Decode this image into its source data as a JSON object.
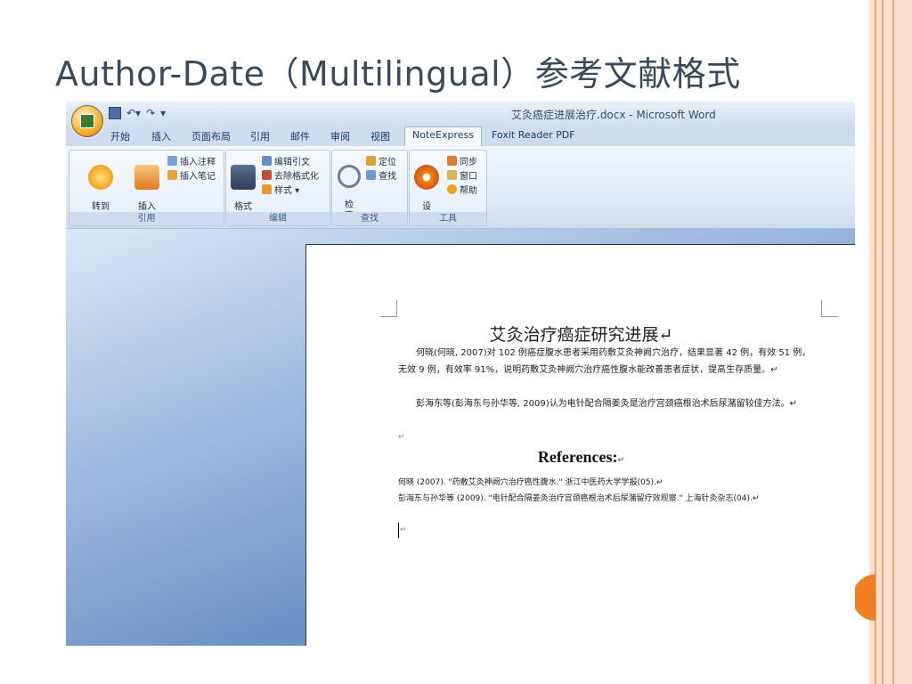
{
  "slide": {
    "title": "Author-Date（Multilingual）参考文献格式"
  },
  "window": {
    "title": "艾灸癌症进展治疗.docx - Microsoft Word",
    "qat": [
      "save-icon",
      "undo-icon",
      "redo-icon",
      "customize-icon"
    ]
  },
  "tabs": [
    {
      "label": "开始"
    },
    {
      "label": "插入"
    },
    {
      "label": "页面布局"
    },
    {
      "label": "引用"
    },
    {
      "label": "邮件"
    },
    {
      "label": "审阅"
    },
    {
      "label": "视图"
    },
    {
      "label": "NoteExpress",
      "active": true
    },
    {
      "label": "Foxit Reader PDF"
    }
  ],
  "ribbon": {
    "groups": {
      "cite": {
        "label": "引用",
        "goto": "转到\nNoteExpress",
        "insert_cite": "插入\n引文",
        "insert_note": "插入注释",
        "insert_memo": "插入笔记"
      },
      "edit": {
        "label": "编辑",
        "format": "格式\n化",
        "edit_cite": "编辑引文",
        "remove_format": "去除格式化",
        "style": "样式 ▾"
      },
      "find": {
        "label": "查找",
        "search": "检\n索",
        "locate": "定位",
        "find": "查找"
      },
      "tools": {
        "label": "工具",
        "settings": "设\n置",
        "sync": "同步",
        "window": "窗口",
        "help": "帮助"
      }
    }
  },
  "document": {
    "title": "艾灸治疗癌症研究进展↵",
    "para1": "何晓(何晓, 2007)对 102 例癌症腹水患者采用药敷艾灸神阙穴治疗，结果显著 42 例，有效 51 例，无效 9 例，有效率 91%，说明药敷艾灸神阙穴治疗癌性腹水能改善患者症状，提高生存质量。↵",
    "para2": "彭海东等(彭海东与孙华等, 2009)认为电针配合隔姜灸是治疗宫颈癌根治术后尿潴留较佳方法。↵",
    "empty_mark": "↵",
    "references_heading": "References:",
    "references_mark": "↵",
    "ref1": "何晓 (2007). \"药敷艾灸神阙穴治疗癌性腹水.\"  浙江中医药大学学报(05).↵",
    "ref2": "彭海东与孙华等 (2009). \"电针配合隔姜灸治疗宫颈癌根治术后尿潴留疗效观察.\" 上海针灸杂志(04).↵",
    "cursor_mark": "↵"
  },
  "colors": {
    "accent": "#f07f22",
    "border": "#fde0cf",
    "title": "#3b4a5a"
  }
}
